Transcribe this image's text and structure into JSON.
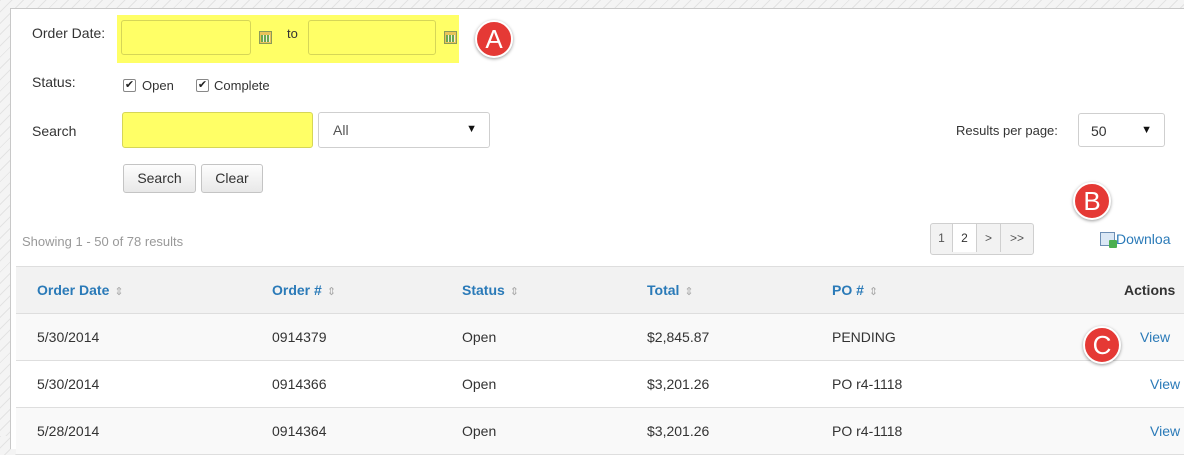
{
  "filters": {
    "order_date_label": "Order Date:",
    "to_label": "to",
    "date_from_value": "",
    "date_to_value": "",
    "status_label": "Status:",
    "status_open_label": "Open",
    "status_complete_label": "Complete",
    "status_open_checked": true,
    "status_complete_checked": true,
    "search_label": "Search",
    "search_value": "",
    "search_scope": "All",
    "results_per_page_label": "Results per page:",
    "results_per_page_value": "50",
    "search_button": "Search",
    "clear_button": "Clear"
  },
  "badges": {
    "a": "A",
    "b": "B",
    "c": "C"
  },
  "results": {
    "showing_text": "Showing 1 - 50 of 78 results",
    "pager": [
      "1",
      "2",
      ">",
      ">>"
    ],
    "download_label": "Downloa"
  },
  "table": {
    "headers": [
      "Order Date",
      "Order #",
      "Status",
      "Total",
      "PO #",
      "Actions"
    ],
    "sort_glyph": "⇕",
    "rows": [
      [
        "5/30/2014",
        "0914379",
        "Open",
        "$2,845.87",
        "PENDING",
        "View"
      ],
      [
        "5/30/2014",
        "0914366",
        "Open",
        "$3,201.26",
        "PO r4-1118",
        "View"
      ],
      [
        "5/28/2014",
        "0914364",
        "Open",
        "$3,201.26",
        "PO r4-1118",
        "View"
      ]
    ]
  },
  "colors": {
    "highlight": "#ffff66",
    "link": "#2a7ab8",
    "badge": "#e53935"
  },
  "icons": [
    "calendar-icon",
    "checkbox-icon",
    "dropdown-arrow-icon",
    "download-icon",
    "sort-icon"
  ]
}
